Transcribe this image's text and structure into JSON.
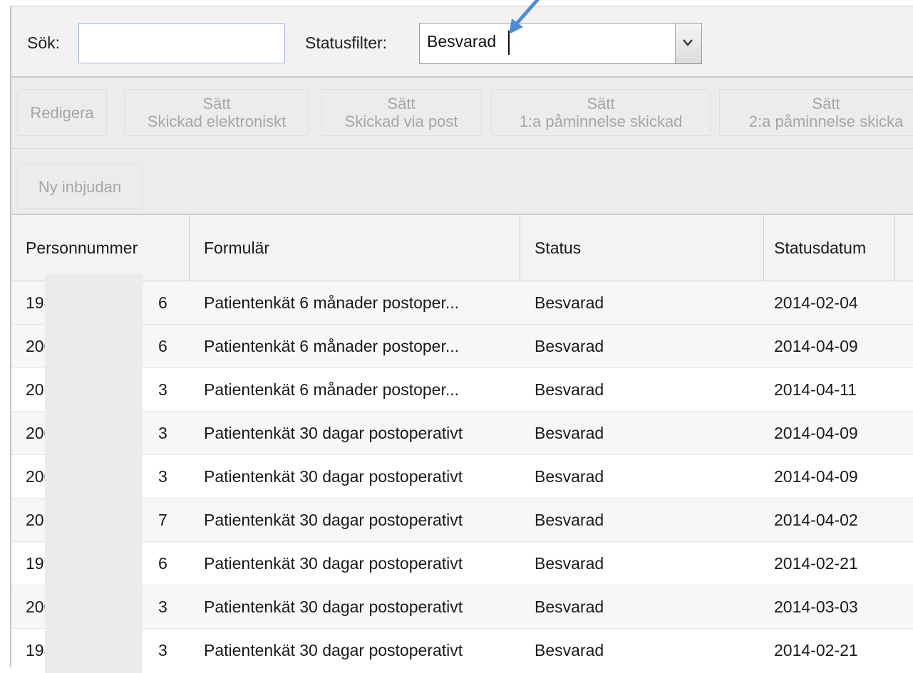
{
  "search": {
    "label": "Sök:",
    "value": ""
  },
  "status_filter": {
    "label": "Statusfilter:",
    "value": "Besvarad"
  },
  "toolbar": {
    "edit": "Redigera",
    "btn_sent_electronic": [
      "Sätt",
      "Skickad elektroniskt"
    ],
    "btn_sent_post": [
      "Sätt",
      "Skickad via post"
    ],
    "btn_reminder1": [
      "Sätt",
      "1:a påminnelse skickad"
    ],
    "btn_reminder2": [
      "Sätt",
      "2:a påminnelse skicka"
    ],
    "new_invite": "Ny inbjudan"
  },
  "table": {
    "columns": [
      "Personnummer",
      "Formulär",
      "Status",
      "Statusdatum"
    ],
    "rows": [
      {
        "pnr_start": "198",
        "pnr_end": "6",
        "form": "Patientenkät 6 månader postoper...",
        "status": "Besvarad",
        "date": "2014-02-04"
      },
      {
        "pnr_start": "200",
        "pnr_end": "6",
        "form": "Patientenkät 6 månader postoper...",
        "status": "Besvarad",
        "date": "2014-04-09"
      },
      {
        "pnr_start": "201",
        "pnr_end": "3",
        "form": "Patientenkät 6 månader postoper...",
        "status": "Besvarad",
        "date": "2014-04-11"
      },
      {
        "pnr_start": "200",
        "pnr_end": "3",
        "form": "Patientenkät 30 dagar postoperativt",
        "status": "Besvarad",
        "date": "2014-04-09"
      },
      {
        "pnr_start": "200",
        "pnr_end": "3",
        "form": "Patientenkät 30 dagar postoperativt",
        "status": "Besvarad",
        "date": "2014-04-09"
      },
      {
        "pnr_start": "201",
        "pnr_end": "7",
        "form": "Patientenkät 30 dagar postoperativt",
        "status": "Besvarad",
        "date": "2014-04-02"
      },
      {
        "pnr_start": "199",
        "pnr_end": "6",
        "form": "Patientenkät 30 dagar postoperativt",
        "status": "Besvarad",
        "date": "2014-02-21"
      },
      {
        "pnr_start": "200",
        "pnr_end": "3",
        "form": "Patientenkät 30 dagar postoperativt",
        "status": "Besvarad",
        "date": "2014-03-03"
      },
      {
        "pnr_start": "198",
        "pnr_end": "3",
        "form": "Patientenkät 30 dagar postoperativt",
        "status": "Besvarad",
        "date": "2014-02-21"
      }
    ]
  },
  "colors": {
    "annotation_arrow": "#4a8fd6",
    "disabled_text": "#a6a6a6",
    "header_bg": "#f3f3f3"
  }
}
